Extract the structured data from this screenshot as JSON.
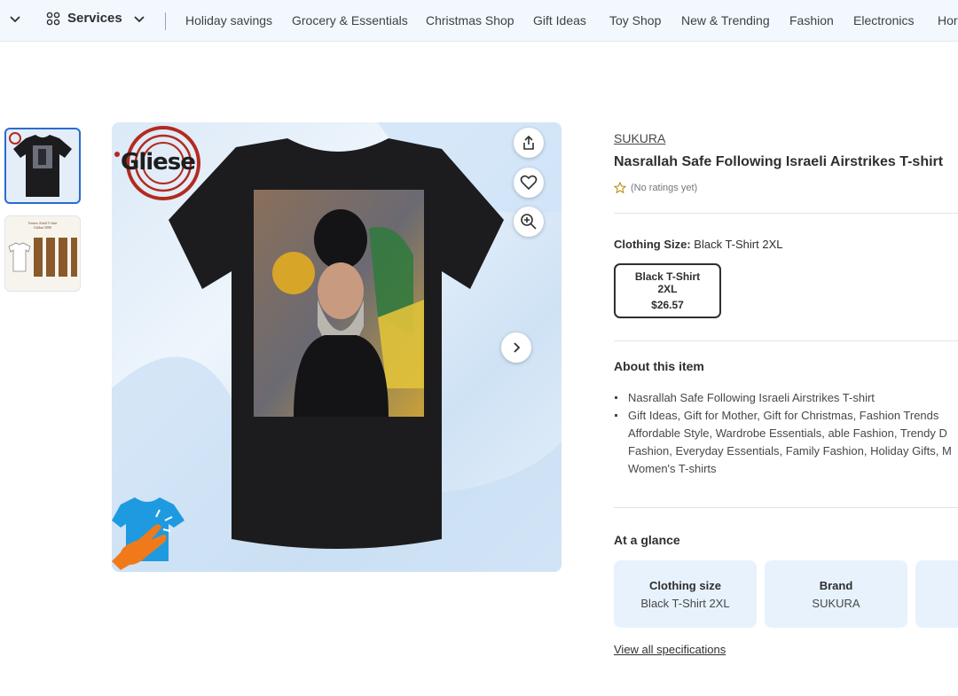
{
  "nav": {
    "services_label": "Services",
    "links": [
      "Holiday savings",
      "Grocery & Essentials",
      "Christmas Shop",
      "Gift Ideas",
      "Toy Shop",
      "New & Trending",
      "Fashion",
      "Electronics",
      "Hor"
    ]
  },
  "product": {
    "brand": "SUKURA",
    "title": "Nasrallah Safe Following Israeli Airstrikes T-shirt",
    "rating_text": "(No ratings yet)",
    "logo_text": "Gliese",
    "thumb2_caption": "Unisex Adult T-shirt\nGildan 5000",
    "clothing_size_label": "Clothing Size:",
    "clothing_size_value": "Black T-Shirt 2XL",
    "size_option": {
      "line1": "Black T-Shirt",
      "line2": "2XL",
      "price": "$26.57"
    }
  },
  "about": {
    "heading": "About this item",
    "bullets": [
      "Nasrallah Safe Following Israeli Airstrikes T-shirt",
      "Gift Ideas, Gift for Mother, Gift for Christmas, Fashion Trends\nAffordable Style, Wardrobe Essentials, able Fashion, Trendy D\nFashion, Everyday Essentials, Family Fashion, Holiday Gifts, M\nWomen's T-shirts"
    ]
  },
  "glance": {
    "heading": "At a glance",
    "cards": [
      {
        "key": "Clothing size",
        "value": "Black T-Shirt 2XL"
      },
      {
        "key": "Brand",
        "value": "SUKURA"
      }
    ]
  },
  "specs_link": "View all specifications",
  "colors": {
    "accent": "#2a6bd1",
    "nav_bg": "#f2f8fd",
    "glance_bg": "#e8f2fc",
    "shirt": "#1c1c1e",
    "logo_red": "#b32a1e"
  },
  "icons": [
    "chevron-down-icon",
    "grid-icon",
    "share-icon",
    "heart-icon",
    "zoom-icon",
    "chevron-right-icon",
    "star-icon",
    "tap-icon"
  ]
}
